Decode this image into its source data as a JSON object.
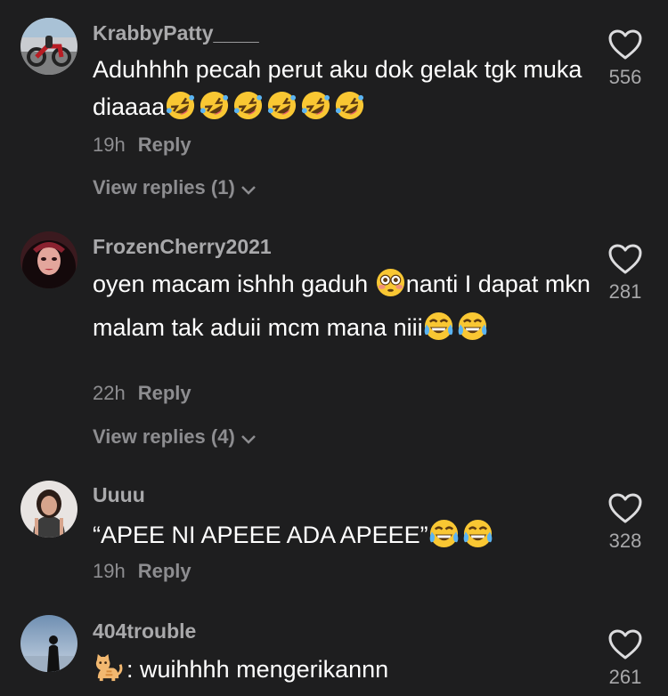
{
  "comments": [
    {
      "username": "KrabbyPatty____",
      "text": "Aduhhhh pecah perut aku dok gelak tgk muka diaaaa",
      "emoji": [
        "rolling-on-floor-laughing",
        "rolling-on-floor-laughing",
        "rolling-on-floor-laughing",
        "rolling-on-floor-laughing",
        "rolling-on-floor-laughing",
        "rolling-on-floor-laughing"
      ],
      "time": "19h",
      "reply_label": "Reply",
      "view_replies": "View replies (1)",
      "likes": "556"
    },
    {
      "username": "FrozenCherry2021",
      "text_a": "oyen macam ishhh gaduh ",
      "emoji_a": "flushed-face",
      "text_b": "nanti I dapat mkn malam tak aduii mcm mana niii",
      "emoji_b": [
        "face-with-tears-of-joy",
        "face-with-tears-of-joy"
      ],
      "time": "22h",
      "reply_label": "Reply",
      "view_replies": "View replies (4)",
      "likes": "281"
    },
    {
      "username": "Uuuu",
      "text": "“APEE NI APEEE ADA APEEE”",
      "emoji": [
        "face-with-tears-of-joy",
        "face-with-tears-of-joy"
      ],
      "time": "19h",
      "reply_label": "Reply",
      "likes": "328"
    },
    {
      "username": "404trouble",
      "emoji": "cat",
      "text": ": wuihhhh mengerikannn",
      "likes": "261"
    }
  ],
  "colors": {
    "background": "#1e1e1f",
    "text": "#ffffff",
    "username": "#a9a9ab",
    "meta": "#8d8d90"
  }
}
